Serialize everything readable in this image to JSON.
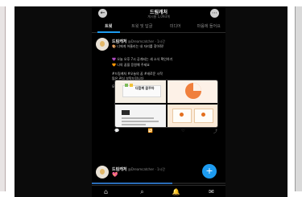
{
  "header": {
    "title": "드림캐처",
    "subtitle": "게시물 1,093개",
    "avatar_glyph": "←",
    "menu_glyph": "⋯"
  },
  "tabs": [
    {
      "label": "트윗",
      "active": true
    },
    {
      "label": "트윗 및 답글",
      "active": false
    },
    {
      "label": "미디어",
      "active": false
    },
    {
      "label": "마음에 들어요",
      "active": false
    }
  ],
  "post": {
    "author": "드림캐처",
    "handle": "@Dreamcatcher · 1시간",
    "lines": [
      "🎨 너에게 어울리는 내 자리를 찾아줘!",
      "",
      "💜 오늘 오후 7시 공개되는 새 소식 확인하기",
      "🧡 나의 꿈을 응원해 주세요",
      "",
      "#드림캐처 #오늘의 꿈 #새로운 시작",
      "많은 관심 부탁드립니다",
      "",
      "모두의 꿈에서 만나요 🙌"
    ],
    "image_caption": "다함께 꿈꾸자",
    "actions": {
      "reply": "💬",
      "retweet": "🔁",
      "like": "♡",
      "share": "⤴"
    }
  },
  "reply": {
    "author": "드림캐처",
    "handle": "@Dreamcatcher · 1시간",
    "heart": "💖"
  },
  "fab_label": "+",
  "progress": 0.6,
  "bottom_nav": {
    "home": "⌂",
    "search": "⌕",
    "notifications": "🔔",
    "messages": "✉"
  },
  "colors": {
    "accent": "#1d9bf0",
    "background": "#000000"
  }
}
